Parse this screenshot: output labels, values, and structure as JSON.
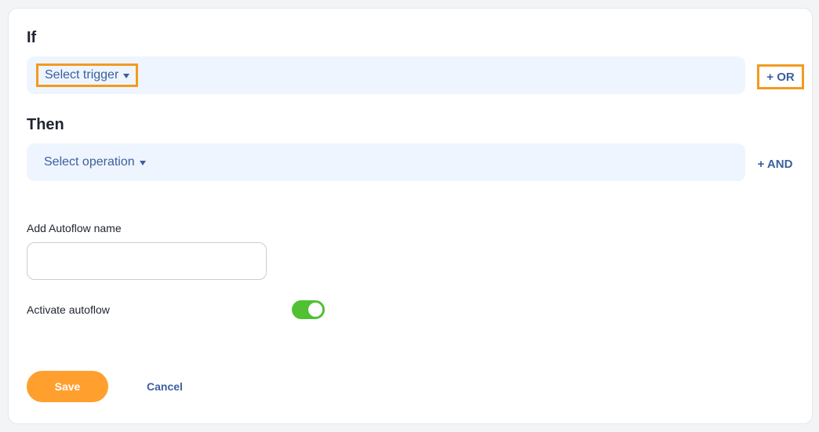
{
  "if_section": {
    "heading": "If",
    "trigger_label": "Select trigger",
    "add_label": "+ OR"
  },
  "then_section": {
    "heading": "Then",
    "operation_label": "Select operation",
    "add_label": "+ AND"
  },
  "name_field": {
    "label": "Add Autoflow name",
    "value": "",
    "placeholder": ""
  },
  "activate": {
    "label": "Activate autoflow",
    "enabled": true
  },
  "actions": {
    "save_label": "Save",
    "cancel_label": "Cancel"
  },
  "colors": {
    "accent": "#ff9f2e",
    "link": "#3c5f9e",
    "toggle_on": "#4fc132",
    "row_bg": "#eef5ff",
    "highlight": "#f39a1f"
  }
}
